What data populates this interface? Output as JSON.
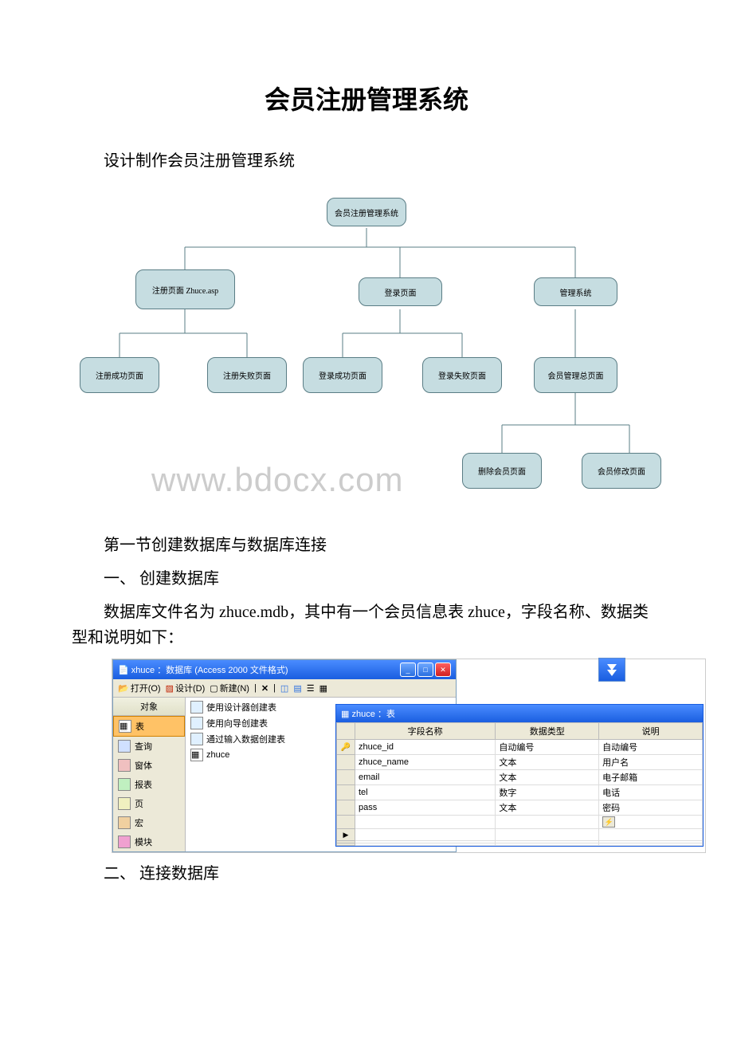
{
  "doc": {
    "title": "会员注册管理系统",
    "intro": "设计制作会员注册管理系统",
    "section1_heading": "第一节创建数据库与数据库连接",
    "section1_sub1": "一、 创建数据库",
    "section1_desc": "数据库文件名为 zhuce.mdb，其中有一个会员信息表 zhuce，字段名称、数据类型和说明如下：",
    "section1_sub2": "二、 连接数据库"
  },
  "watermark": "www.bdocx.com",
  "flowchart": {
    "root": "会员注册管理系统",
    "level1": {
      "reg": "注册页面 Zhuce.asp",
      "login": "登录页面",
      "admin": "管理系统"
    },
    "level2": {
      "reg_success": "注册成功页面",
      "reg_fail": "注册失败页面",
      "login_success": "登录成功页面",
      "login_fail": "登录失败页面",
      "member_mgmt": "会员管理总页面"
    },
    "level3": {
      "delete_member": "删除会员页面",
      "edit_member": "会员修改页面"
    }
  },
  "dbwin": {
    "title": "xhuce ：数据库 (Access 2000 文件格式)",
    "toolbar": {
      "open": "打开(O)",
      "design": "设计(D)",
      "new": "新建(N)"
    },
    "sidebar": {
      "header": "对象",
      "items": [
        "表",
        "查询",
        "窗体",
        "报表",
        "页",
        "宏",
        "模块"
      ]
    },
    "center": {
      "items": [
        "使用设计器创建表",
        "使用向导创建表",
        "通过输入数据创建表",
        "zhuce"
      ]
    }
  },
  "tablewin": {
    "title": "zhuce ：表",
    "headers": [
      "字段名称",
      "数据类型",
      "说明"
    ],
    "rows": [
      {
        "name": "zhuce_id",
        "type": "自动编号",
        "desc": "自动编号",
        "pk": true
      },
      {
        "name": "zhuce_name",
        "type": "文本",
        "desc": "用户名",
        "pk": false
      },
      {
        "name": "email",
        "type": "文本",
        "desc": "电子邮箱",
        "pk": false
      },
      {
        "name": "tel",
        "type": "数字",
        "desc": "电话",
        "pk": false
      },
      {
        "name": "pass",
        "type": "文本",
        "desc": "密码",
        "pk": false
      }
    ]
  }
}
